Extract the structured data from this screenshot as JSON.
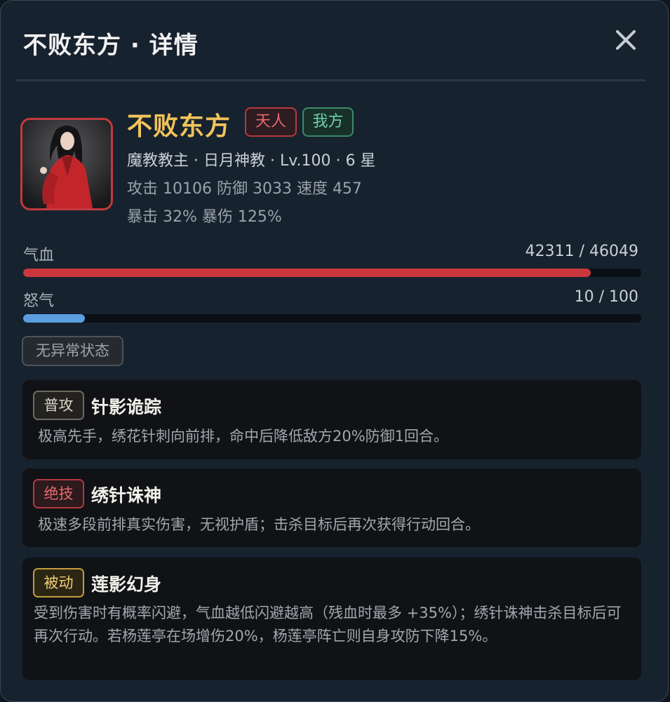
{
  "header": {
    "title": "不败东方 · 详情"
  },
  "hero": {
    "name": "不败东方",
    "tier_tag": "天人",
    "side_tag": "我方",
    "info_line": "魔教教主 · 日月神教 · Lv.100 · 6 星",
    "stats_line": "攻击 10106   防御 3033   速度 457",
    "crit_line": "暴击 32%   暴伤 125%"
  },
  "bars": {
    "hp": {
      "label": "气血",
      "text": "42311 / 46049",
      "current": 42311,
      "max": 46049,
      "color": "#c9373d"
    },
    "rage": {
      "label": "怒气",
      "text": "10 / 100",
      "current": 10,
      "max": 100,
      "color": "#5b9ee0"
    }
  },
  "status": {
    "label": "无异常状态"
  },
  "skills": [
    {
      "type": "普攻",
      "name": "针影诡踪",
      "desc": "极高先手，绣花针刺向前排，命中后降低敌方20%防御1回合。"
    },
    {
      "type": "绝技",
      "name": "绣针诛神",
      "desc": "极速多段前排真实伤害，无视护盾；击杀目标后再次获得行动回合。"
    },
    {
      "type": "被动",
      "name": "莲影幻身",
      "desc": "受到伤害时有概率闪避，气血越低闪避越高（残血时最多 +35%）；绣针诛神击杀目标后可再次行动。若杨莲亭在场增伤20%，杨莲亭阵亡则自身攻防下降15%。"
    }
  ],
  "colors": {
    "accent_gold": "#f0c45a",
    "tier_red": "#e5686b",
    "side_green": "#6fd0a8"
  },
  "icons": {
    "close": "close-icon",
    "portrait": "hero-portrait"
  }
}
